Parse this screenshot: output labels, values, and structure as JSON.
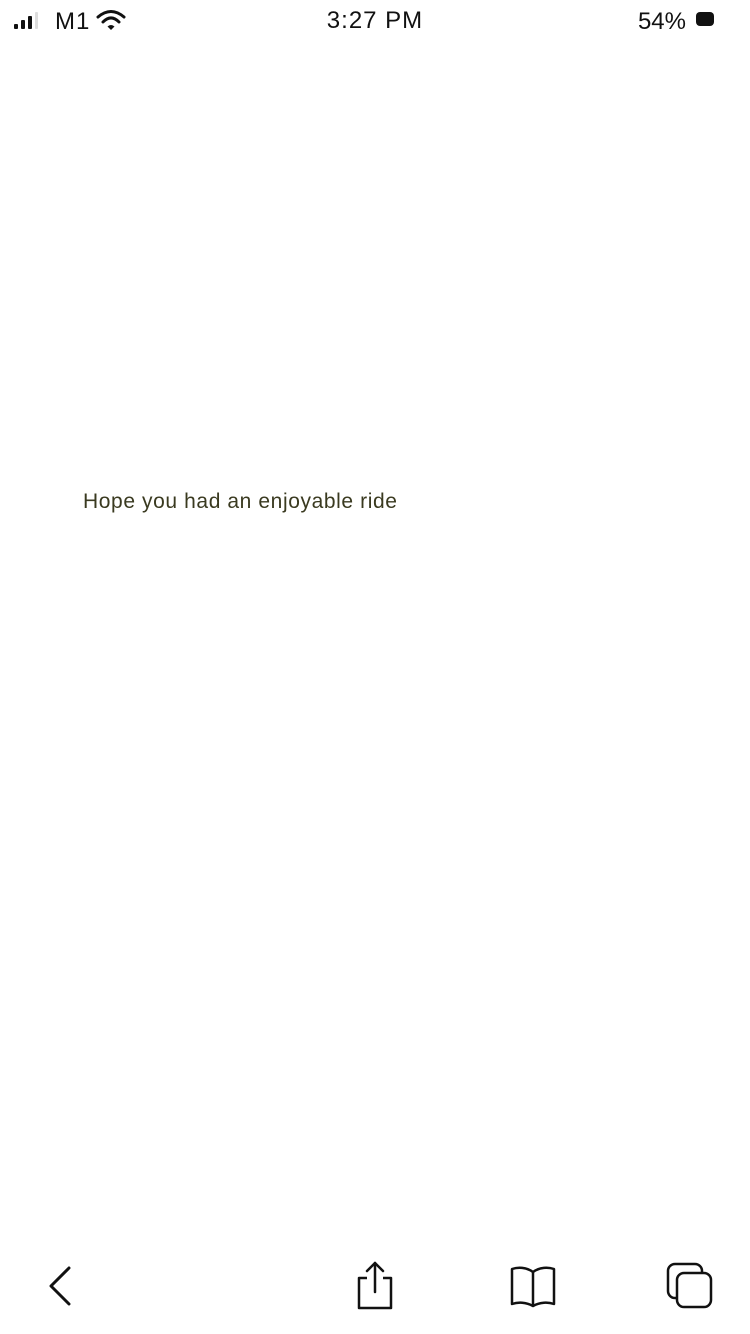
{
  "status_bar": {
    "carrier": "M1",
    "time": "3:27 PM",
    "battery_percent": "54%",
    "icons": [
      "signal-icon",
      "wifi-icon",
      "battery-icon"
    ]
  },
  "main": {
    "message": "Hope you had an enjoyable ride"
  },
  "toolbar": {
    "icons": [
      "back-icon",
      "share-icon",
      "bookmarks-icon",
      "tabs-icon"
    ]
  }
}
